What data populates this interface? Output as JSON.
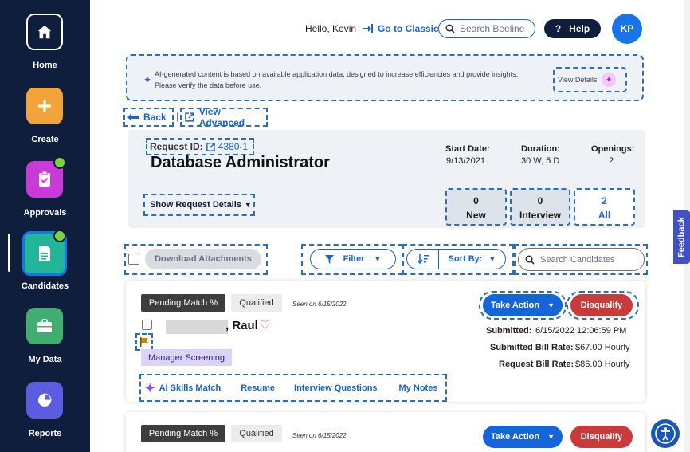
{
  "sidebar": {
    "items": [
      {
        "label": "Home",
        "icon": "home-icon",
        "color": "#0f1e3d"
      },
      {
        "label": "Create",
        "icon": "plus-icon",
        "color": "#f2a33a"
      },
      {
        "label": "Approvals",
        "icon": "clipboard-check-icon",
        "color": "#c93ad9"
      },
      {
        "label": "Candidates",
        "icon": "document-icon",
        "color": "#22b59a"
      },
      {
        "label": "My Data",
        "icon": "briefcase-icon",
        "color": "#3fae6e"
      },
      {
        "label": "Reports",
        "icon": "pie-chart-icon",
        "color": "#5b5ce0"
      }
    ]
  },
  "header": {
    "greeting": "Hello, Kevin",
    "classic_link": "Go to Classic",
    "search_placeholder": "Search Beeline",
    "help_label": "Help",
    "help_glyph": "?",
    "avatar_initials": "KP"
  },
  "ai_banner": {
    "text": "AI-generated content is based on available application data, designed to increase efficiencies and provide insights. Please verify the data before use.",
    "view_details": "View Details"
  },
  "nav": {
    "back": "Back",
    "separator": "|",
    "view_advanced": "View Advanced"
  },
  "request": {
    "id_label": "Request ID:",
    "id_value": "4380-1",
    "title": "Database Administrator",
    "start_date_label": "Start Date:",
    "start_date": "9/13/2021",
    "duration_label": "Duration:",
    "duration": "30 W, 5 D",
    "openings_label": "Openings:",
    "openings": "2",
    "show_details": "Show Request Details",
    "counts": [
      {
        "value": "0",
        "label": "New"
      },
      {
        "value": "0",
        "label": "Interview"
      },
      {
        "value": "2",
        "label": "All"
      }
    ]
  },
  "toolbar": {
    "download": "Download Attachments",
    "filter": "Filter",
    "sort": "Sort By:",
    "search_placeholder": "Search Candidates"
  },
  "candidates": [
    {
      "tag_match": "Pending Match %",
      "tag_qualified": "Qualified",
      "seen": "Seen on 6/15/2022",
      "take_action": "Take Action",
      "disqualify": "Disqualify",
      "name": ", Raul",
      "submitted_label": "Submitted:",
      "submitted": "6/15/2022 12:06:59 PM",
      "submitted_bill_label": "Submitted Bill Rate:",
      "submitted_bill": "$67.00 Hourly",
      "request_bill_label": "Request Bill Rate:",
      "request_bill": "$86.00 Hourly",
      "status": "Manager Screening",
      "links": [
        "AI Skills Match",
        "Resume",
        "Interview Questions",
        "My Notes"
      ]
    },
    {
      "tag_match": "Pending Match %",
      "tag_qualified": "Qualified",
      "seen": "Seen on 6/15/2022",
      "take_action": "Take Action",
      "disqualify": "Disqualify"
    }
  ],
  "feedback": "Feedback",
  "colors": {
    "sidebar_bg": "#0f1e3d",
    "accent_blue": "#1d63c4",
    "danger_red": "#c93a3a",
    "status_purple": "#dcd3fb"
  }
}
